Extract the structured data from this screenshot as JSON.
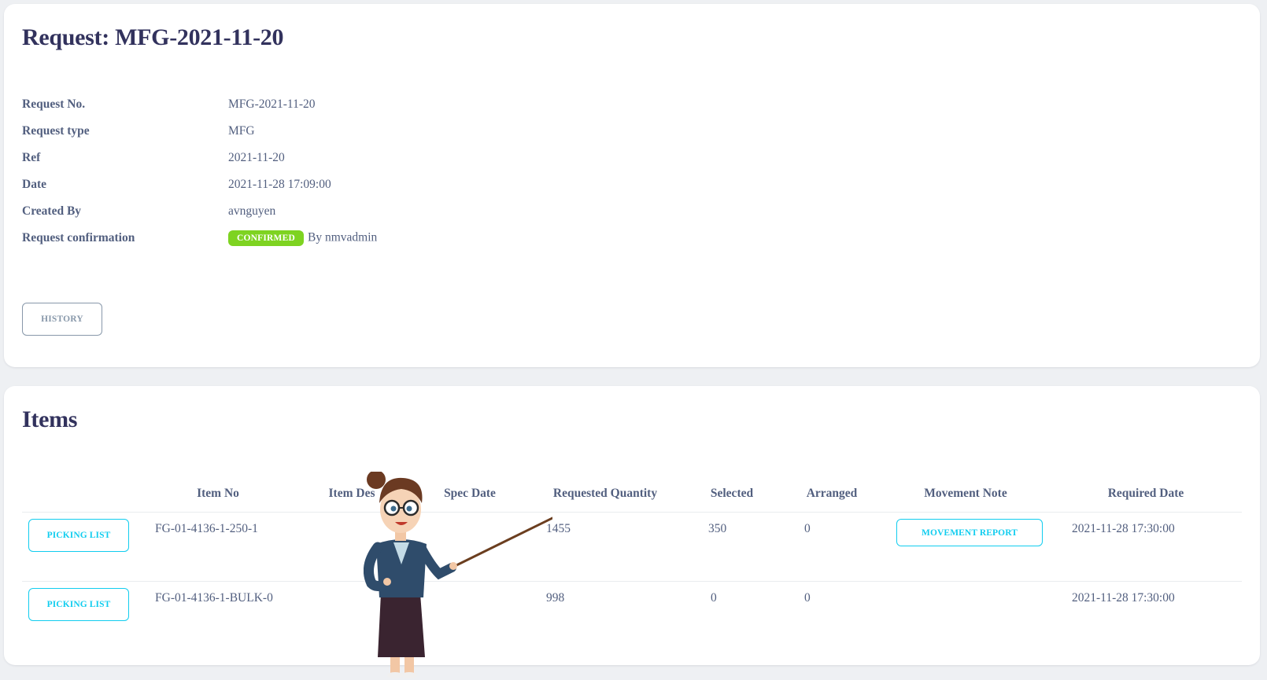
{
  "request": {
    "title": "Request: MFG-2021-11-20",
    "fields": [
      {
        "label": "Request No.",
        "value": "MFG-2021-11-20"
      },
      {
        "label": "Request type",
        "value": "MFG"
      },
      {
        "label": "Ref",
        "value": "2021-11-20"
      },
      {
        "label": "Date",
        "value": "2021-11-28 17:09:00"
      },
      {
        "label": "Created By",
        "value": "avnguyen"
      }
    ],
    "confirmation": {
      "label": "Request confirmation",
      "status": "CONFIRMED",
      "by_text": "By nmvadmin",
      "status_color": "#7ed321"
    },
    "history_button": "HISTORY"
  },
  "items": {
    "title": "Items",
    "columns": [
      "Item No",
      "Item Des",
      "Spec Date",
      "Requested Quantity",
      "Selected",
      "Arranged",
      "Movement Note",
      "Required Date"
    ],
    "rows": [
      {
        "action": "PICKING LIST",
        "item_no": "FG-01-4136-1-250-1",
        "item_des": "",
        "spec_date": "",
        "requested_quantity": "1455",
        "selected": "350",
        "arranged": "0",
        "movement_note": "MOVEMENT REPORT",
        "required_date": "2021-11-28 17:30:00"
      },
      {
        "action": "PICKING LIST",
        "item_no": "FG-01-4136-1-BULK-0",
        "item_des": "",
        "spec_date": "",
        "requested_quantity": "998",
        "selected": "0",
        "arranged": "0",
        "movement_note": "",
        "required_date": "2021-11-28 17:30:00"
      }
    ]
  },
  "colors": {
    "accent_info": "#11cdef",
    "heading": "#32325d",
    "text": "#525f7f"
  },
  "icons": {
    "mascot": "teacher-with-pointer-illustration"
  }
}
